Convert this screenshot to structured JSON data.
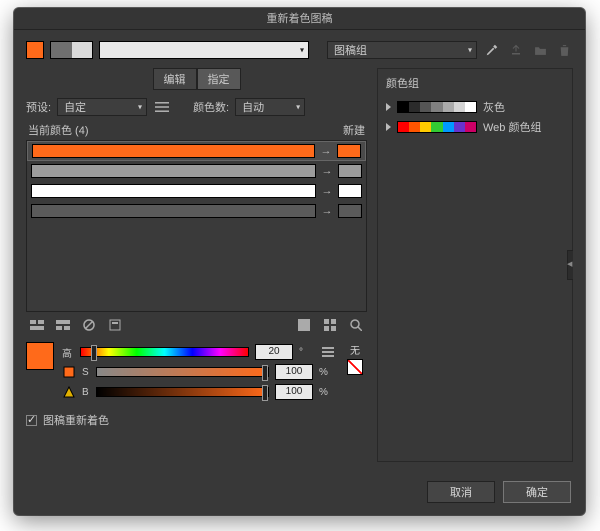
{
  "title": "重新着色图稿",
  "top": {
    "mainColor": "#ff6a1a",
    "chipA": "#6f6f6f",
    "chipB": "#d9d9d9",
    "groupDropdownLabel": "图稿组"
  },
  "tabs": {
    "edit": "编辑",
    "assign": "指定"
  },
  "presetRow": {
    "presetLabel": "预设:",
    "presetValue": "自定",
    "colorCountLabel": "颜色数:",
    "colorCountValue": "自动"
  },
  "tableHeader": {
    "left": "当前颜色 (4)",
    "right": "新建"
  },
  "colorRows": [
    {
      "bar": "#ff6a1a",
      "end": "#ff6a1a",
      "selected": true
    },
    {
      "bar": "#9c9c9c",
      "end": "#9c9c9c",
      "selected": false
    },
    {
      "bar": "#ffffff",
      "end": "#ffffff",
      "selected": false
    },
    {
      "bar": "#5a5a5a",
      "end": "#5a5a5a",
      "selected": false
    }
  ],
  "hsb": {
    "swatch": "#ff6a1a",
    "hLabel": "高",
    "hValue": "20",
    "hUnit": "°",
    "sLabel": "S",
    "sValue": "100",
    "sUnit": "%",
    "bLabel": "B",
    "bValue": "100",
    "bUnit": "%",
    "noneLabel": "无"
  },
  "checkbox": {
    "label": "图稿重新着色"
  },
  "rightPanel": {
    "title": "颜色组",
    "items": [
      {
        "label": "灰色",
        "colors": [
          "#000000",
          "#2b2b2b",
          "#555555",
          "#808080",
          "#aaaaaa",
          "#d4d4d4",
          "#ffffff"
        ]
      },
      {
        "label": "Web 颜色组",
        "colors": [
          "#ff0000",
          "#ff5500",
          "#ffcc00",
          "#33cc33",
          "#0099ff",
          "#6633cc",
          "#cc0066"
        ]
      }
    ]
  },
  "footer": {
    "cancel": "取消",
    "ok": "确定"
  }
}
